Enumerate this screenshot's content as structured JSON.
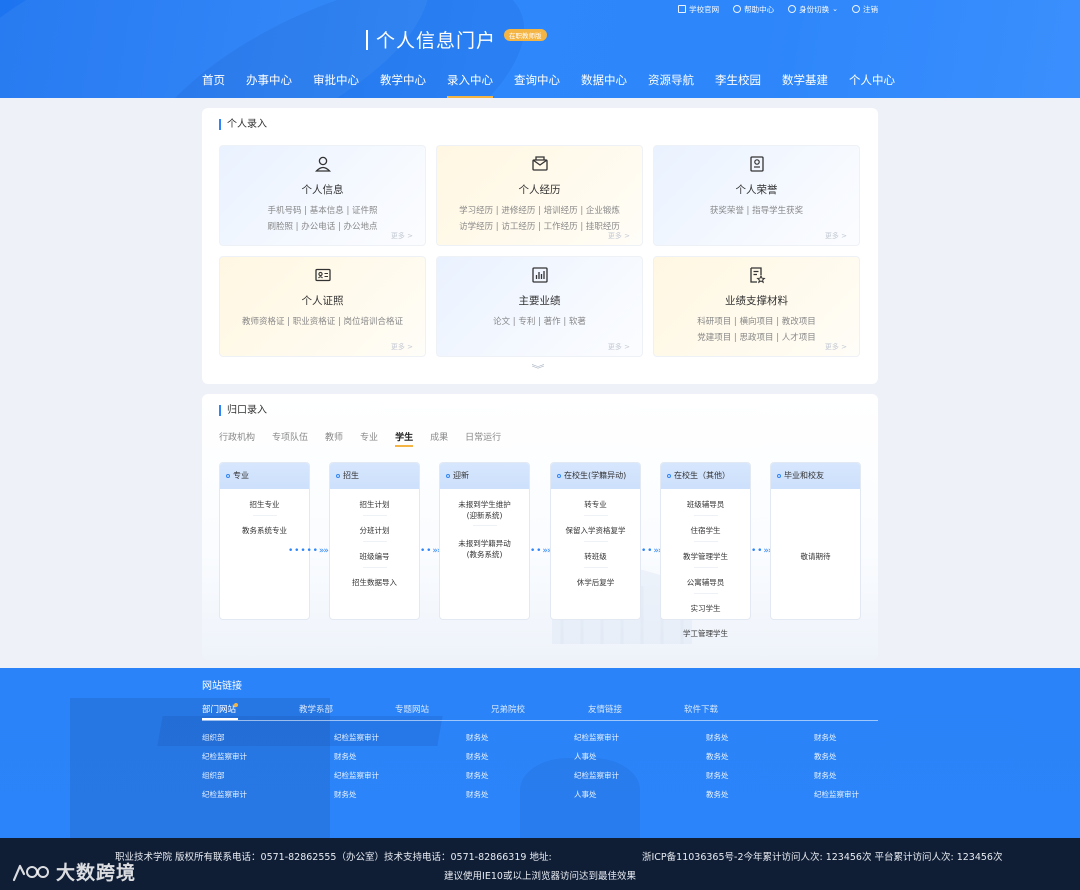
{
  "topbar": [
    {
      "label": "学校官网",
      "icon": "home-icon"
    },
    {
      "label": "帮助中心",
      "icon": "help-icon"
    },
    {
      "label": "身份切换",
      "icon": "user-switch-icon"
    },
    {
      "label": "注销",
      "icon": "logout-icon"
    }
  ],
  "brand": {
    "title": "个人信息门户",
    "badge": "在职教师版"
  },
  "nav": [
    "首页",
    "办事中心",
    "审批中心",
    "教学中心",
    "录入中心",
    "查询中心",
    "数据中心",
    "资源导航",
    "李生校园",
    "数学基建",
    "个人中心"
  ],
  "nav_active": "录入中心",
  "personal": {
    "title": "个人录入",
    "more": "更多 >",
    "cards": [
      {
        "name": "个人信息",
        "icon": "user-icon",
        "line1": "手机号码 | 基本信息 | 证件照",
        "line2": "刷脸照 | 办公电话 | 办公地点"
      },
      {
        "name": "个人经历",
        "icon": "mail-icon",
        "line1": "学习经历 | 进修经历 | 培训经历 | 企业锻炼",
        "line2": "访学经历 | 访工经历 | 工作经历 | 挂职经历"
      },
      {
        "name": "个人荣誉",
        "icon": "honor-icon",
        "line1": "获奖荣誉 | 指导学生获奖",
        "line2": ""
      },
      {
        "name": "个人证照",
        "icon": "id-card-icon",
        "line1": "教师资格证 | 职业资格证 | 岗位培训合格证",
        "line2": ""
      },
      {
        "name": "主要业绩",
        "icon": "chart-icon",
        "line1": "论文 | 专利 | 著作 | 软著",
        "line2": ""
      },
      {
        "name": "业绩支撑材料",
        "icon": "document-star-icon",
        "line1": "科研项目 | 横向项目 | 教改项目",
        "line2": "党建项目 | 思政项目 | 人才项目"
      }
    ]
  },
  "guikou": {
    "title": "归口录入",
    "tabs": [
      "行政机构",
      "专项队伍",
      "教师",
      "专业",
      "学生",
      "成果",
      "日常运行"
    ],
    "active_tab": "学生",
    "columns": [
      {
        "title": "专业",
        "items": [
          "招生专业",
          "教务系统专业"
        ]
      },
      {
        "title": "招生",
        "items": [
          "招生计划",
          "分班计划",
          "班级编号",
          "招生数据导入"
        ]
      },
      {
        "title": "迎新",
        "items": [
          "未报到学生维护\n(迎新系统)",
          "未报到学籍异动\n(教务系统)"
        ]
      },
      {
        "title": "在校生(学籍异动)",
        "items": [
          "转专业",
          "保留入学资格复学",
          "转班级",
          "休学后复学"
        ]
      },
      {
        "title": "在校生（其他）",
        "items": [
          "班级辅导员",
          "住宿学生",
          "教学管理学生",
          "公寓辅导员",
          "实习学生",
          "学工管理学生"
        ]
      },
      {
        "title": "毕业和校友",
        "items": [
          "敬请期待"
        ]
      }
    ]
  },
  "links": {
    "title": "网站链接",
    "tabs": [
      "部门网站",
      "教学系部",
      "专题网站",
      "兄弟院校",
      "友情链接",
      "软件下载"
    ],
    "active_tab": "部门网站",
    "rows": [
      [
        "组织部",
        "纪检监察审计",
        "财务处",
        "纪检监察审计",
        "财务处",
        "财务处"
      ],
      [
        "纪检监察审计",
        "财务处",
        "财务处",
        "人事处",
        "教务处",
        "教务处"
      ],
      [
        "组织部",
        "纪检监察审计",
        "财务处",
        "纪检监察审计",
        "财务处",
        "财务处"
      ],
      [
        "纪检监察审计",
        "财务处",
        "财务处",
        "人事处",
        "教务处",
        "纪检监察审计"
      ]
    ]
  },
  "footer": {
    "line1": "职业技术学院 版权所有联系电话：0571-82862555（办公室）技术支持电话：0571-82866319 地址:",
    "line2": "浙ICP备11036365号-2今年累计访问人次: 123456次  平台累计访问人次: 123456次",
    "line3": "建议使用IE10或以上浏览器访问达到最佳效果"
  },
  "watermark": "大数跨境",
  "colors": {
    "accent": "#2e85f9",
    "highlight": "#f4b544",
    "footer_dark": "#0f1d35"
  }
}
